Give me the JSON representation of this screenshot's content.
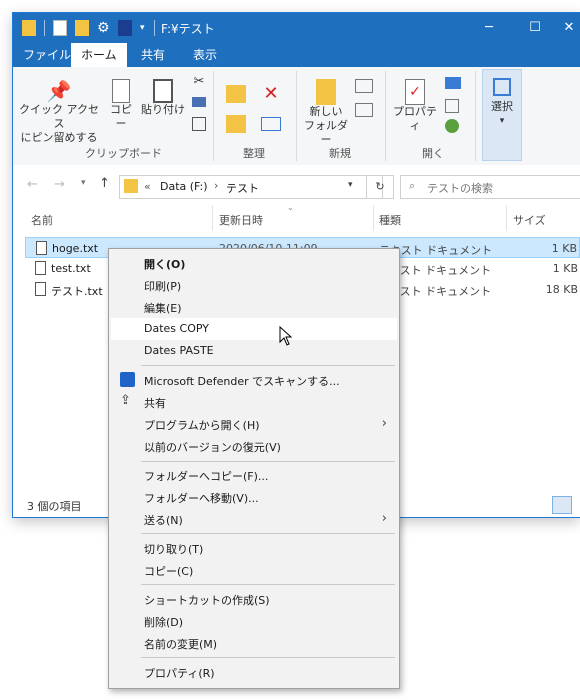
{
  "window": {
    "title": "F:¥テスト"
  },
  "ribbon_tabs": [
    "ファイル",
    "ホーム",
    "共有",
    "表示"
  ],
  "ribbon": {
    "pin_label_1": "クイック アクセス",
    "pin_label_2": "にピン留めする",
    "copy_label": "コピー",
    "paste_label": "貼り付け",
    "clipboard_group": "クリップボード",
    "organize_group": "整理",
    "new_folder_1": "新しい",
    "new_folder_2": "フォルダー",
    "new_group": "新規",
    "properties_label": "プロパティ",
    "open_group": "開く",
    "select_label": "選択"
  },
  "address": {
    "prefix": "«",
    "path1": "Data (F:)",
    "sep": "›",
    "path2": "テスト",
    "search_placeholder": "テストの検索"
  },
  "columns": {
    "name": "名前",
    "date": "更新日時",
    "type": "種類",
    "size": "サイズ"
  },
  "files": [
    {
      "name": "hoge.txt",
      "date": "2020/06/10 11:09",
      "type": "テキスト ドキュメント",
      "size": "1 KB"
    },
    {
      "name": "test.txt",
      "type": "テキスト ドキュメント",
      "size": "1 KB"
    },
    {
      "name": "テスト.txt",
      "type": "テキスト ドキュメント",
      "size": "18 KB"
    }
  ],
  "status": {
    "count": "3 個の項目"
  },
  "context_menu": {
    "open": "開く(O)",
    "print": "印刷(P)",
    "edit": "編集(E)",
    "dates_copy": "Dates COPY",
    "dates_paste": "Dates PASTE",
    "defender": "Microsoft Defender でスキャンする...",
    "share": "共有",
    "open_with": "プログラムから開く(H)",
    "restore": "以前のバージョンの復元(V)",
    "copy_to": "フォルダーへコピー(F)...",
    "move_to": "フォルダーへ移動(V)...",
    "send_to": "送る(N)",
    "cut": "切り取り(T)",
    "copy": "コピー(C)",
    "shortcut": "ショートカットの作成(S)",
    "delete": "削除(D)",
    "rename": "名前の変更(M)",
    "properties": "プロパティ(R)"
  }
}
